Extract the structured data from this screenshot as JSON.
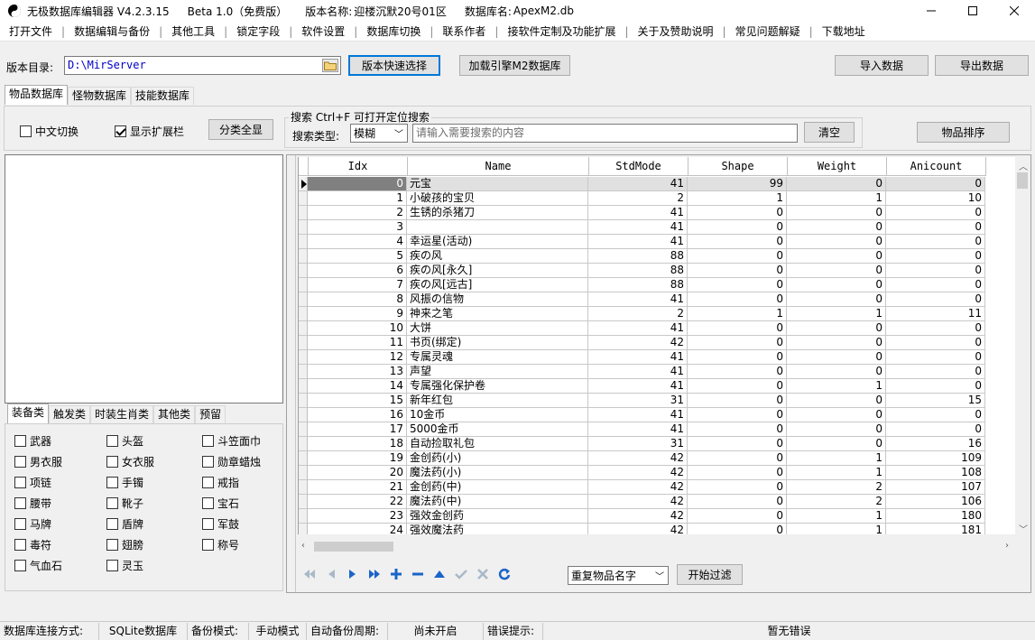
{
  "title": {
    "app": "无极数据库编辑器 V4.2.3.15",
    "beta": "Beta 1.0（免费版）",
    "version_name_label": "版本名称:",
    "version_name": "迎楼沉默20号01区",
    "db_name_label": "数据库名:",
    "db_name": "ApexM2.db"
  },
  "menu": [
    "打开文件",
    "数据编辑与备份",
    "其他工具",
    "锁定字段",
    "软件设置",
    "数据库切换",
    "联系作者",
    "接软件定制及功能扩展",
    "关于及赞助说明",
    "常见问题解疑",
    "下载地址"
  ],
  "toolbar": {
    "version_dir_label": "版本目录:",
    "version_dir_value": "D:\\MirServer",
    "quick_select": "版本快速选择",
    "load_engine": "加载引擎M2数据库",
    "import": "导入数据",
    "export": "导出数据"
  },
  "tabs": [
    "物品数据库",
    "怪物数据库",
    "技能数据库"
  ],
  "filter": {
    "chinese_switch": "中文切换",
    "show_ext": "显示扩展栏",
    "show_all": "分类全显",
    "search_title": "搜索  Ctrl+F 可打开定位搜索",
    "search_type_label": "搜索类型:",
    "search_type": "模糊",
    "search_placeholder": "请输入需要搜索的内容",
    "clear": "清空",
    "sort": "物品排序"
  },
  "category_tabs": [
    "装备类",
    "触发类",
    "时装生肖类",
    "其他类",
    "预留"
  ],
  "categories": [
    [
      "武器",
      "头盔",
      "斗笠面巾"
    ],
    [
      "男衣服",
      "女衣服",
      "勋章蜡烛"
    ],
    [
      "项链",
      "手镯",
      "戒指"
    ],
    [
      "腰带",
      "靴子",
      "宝石"
    ],
    [
      "马牌",
      "盾牌",
      "军鼓"
    ],
    [
      "毒符",
      "翅膀",
      "称号"
    ],
    [
      "气血石",
      "灵玉",
      ""
    ]
  ],
  "grid": {
    "columns": [
      "Idx",
      "Name",
      "StdMode",
      "Shape",
      "Weight",
      "Anicount"
    ],
    "rows": [
      [
        "0",
        "元宝",
        "41",
        "99",
        "0",
        "0"
      ],
      [
        "1",
        "小破孩的宝贝",
        "2",
        "1",
        "1",
        "10"
      ],
      [
        "2",
        "生锈的杀猪刀",
        "41",
        "0",
        "0",
        "0"
      ],
      [
        "3",
        "",
        "41",
        "0",
        "0",
        "0"
      ],
      [
        "4",
        "幸运星(活动)",
        "41",
        "0",
        "0",
        "0"
      ],
      [
        "5",
        "疾の风",
        "88",
        "0",
        "0",
        "0"
      ],
      [
        "6",
        "疾の风[永久]",
        "88",
        "0",
        "0",
        "0"
      ],
      [
        "7",
        "疾の风[远古]",
        "88",
        "0",
        "0",
        "0"
      ],
      [
        "8",
        "风振の信物",
        "41",
        "0",
        "0",
        "0"
      ],
      [
        "9",
        "神来之笔",
        "2",
        "1",
        "1",
        "11"
      ],
      [
        "10",
        "大饼",
        "41",
        "0",
        "0",
        "0"
      ],
      [
        "11",
        "书页(绑定)",
        "42",
        "0",
        "0",
        "0"
      ],
      [
        "12",
        "专属灵魂",
        "41",
        "0",
        "0",
        "0"
      ],
      [
        "13",
        "声望",
        "41",
        "0",
        "0",
        "0"
      ],
      [
        "14",
        "专属强化保护卷",
        "41",
        "0",
        "1",
        "0"
      ],
      [
        "15",
        "新年红包",
        "31",
        "0",
        "0",
        "15"
      ],
      [
        "16",
        "10金币",
        "41",
        "0",
        "0",
        "0"
      ],
      [
        "17",
        "5000金币",
        "41",
        "0",
        "0",
        "0"
      ],
      [
        "18",
        "自动捡取礼包",
        "31",
        "0",
        "0",
        "16"
      ],
      [
        "19",
        "金创药(小)",
        "42",
        "0",
        "1",
        "109"
      ],
      [
        "20",
        "魔法药(小)",
        "42",
        "0",
        "1",
        "108"
      ],
      [
        "21",
        "金创药(中)",
        "42",
        "0",
        "2",
        "107"
      ],
      [
        "22",
        "魔法药(中)",
        "42",
        "0",
        "2",
        "106"
      ],
      [
        "23",
        "强效金创药",
        "42",
        "0",
        "1",
        "180"
      ],
      [
        "24",
        "强效魔法药",
        "42",
        "0",
        "1",
        "181"
      ]
    ]
  },
  "bottom": {
    "dup_select": "重复物品名字",
    "start_filter": "开始过滤"
  },
  "status": {
    "conn_label": "数据库连接方式:",
    "conn_value": "SQLite数据库",
    "backup_label": "备份模式:",
    "backup_value": "手动模式",
    "auto_label": "自动备份周期:",
    "auto_value": "尚未开启",
    "err_label": "错误提示:",
    "err_value": "暂无错误"
  }
}
